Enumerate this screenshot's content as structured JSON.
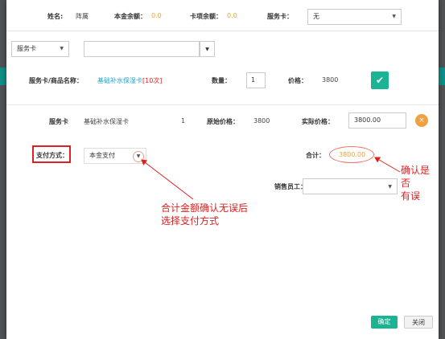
{
  "top": {
    "name_label": "姓名:",
    "name_value": "阵厲",
    "principal_label": "本金余额：",
    "principal_value": "0.0",
    "card_label": "卡项余额：",
    "card_value": "0.0",
    "service_card_label": "服务卡：",
    "service_card_value": "无"
  },
  "search": {
    "type_value": "服务卡",
    "item_value": ""
  },
  "add_row": {
    "label": "服务卡/商品名称：",
    "item_name": "基础补水保湿卡",
    "item_count": "[10次]",
    "qty_label": "数量：",
    "qty_value": "1",
    "price_label": "价格：",
    "price_value": "3800"
  },
  "line_item": {
    "type": "服务卡",
    "name": "基础补水保湿卡",
    "qty": "1",
    "orig_label": "原始价格：",
    "orig_value": "3800",
    "actual_label": "实际价格：",
    "actual_value": "3800.00",
    "remove_icon": "×"
  },
  "payment": {
    "label": "支付方式：",
    "value": "本金支付",
    "total_label": "合计：",
    "total_value": "3800.00",
    "staff_label": "销售员工：",
    "staff_value": ""
  },
  "annotations": {
    "callout_left_line1": "合计金额确认无误后",
    "callout_left_line2": "选择支付方式",
    "callout_right_line1": "确认是否",
    "callout_right_line2": "有误"
  },
  "footer": {
    "confirm": "确定",
    "close": "关闭"
  },
  "colors": {
    "accent": "#1ab394",
    "annotation": "#e02020",
    "amount": "#f0a030"
  }
}
